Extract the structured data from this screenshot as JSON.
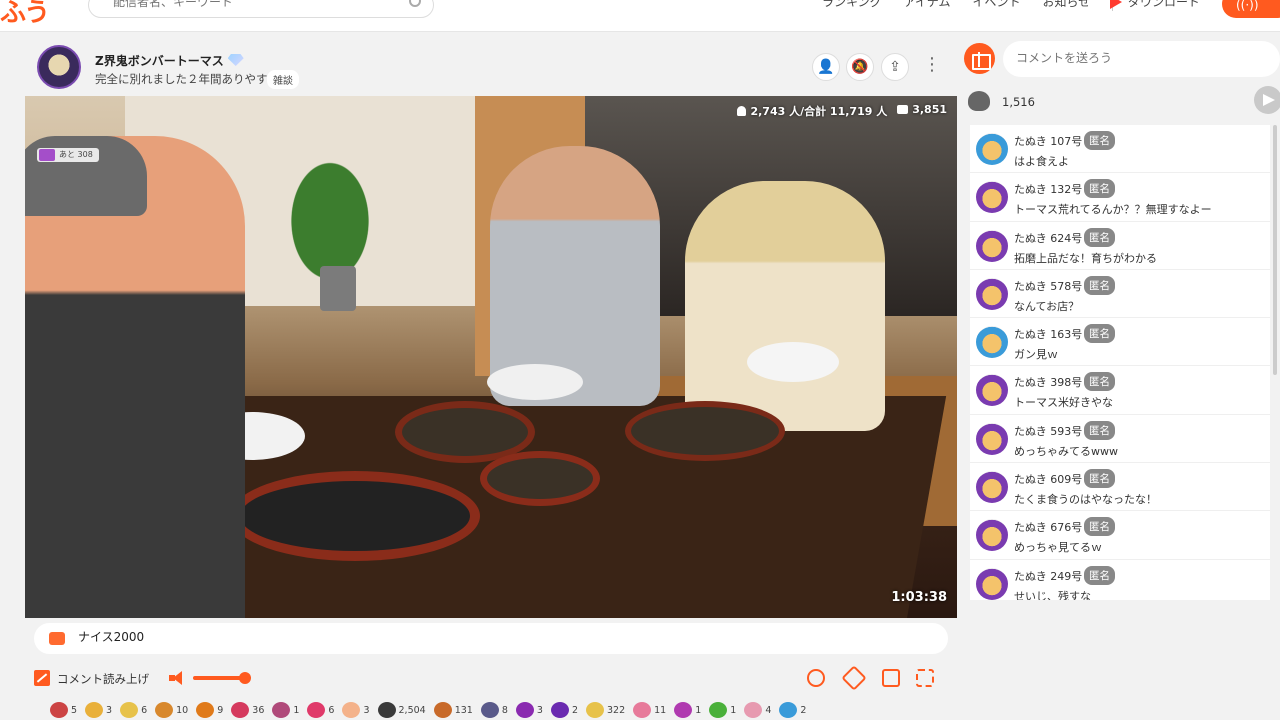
{
  "header": {
    "search_placeholder": "配信者名、キーワード",
    "nav": [
      "ランキング",
      "アイテム",
      "イベント",
      "お知らせ"
    ],
    "download_label": "ダウンロード"
  },
  "stream": {
    "title": "Z界鬼ボンバートーマス",
    "subtitle": "完全に別れました２年間ありやす",
    "tag": "雑談",
    "badge_left": "あと 308",
    "viewers": "2,743 人/合計 11,719 人",
    "comment_count": "3,851",
    "elapsed": "1:03:38"
  },
  "comment_input": {
    "value": "ナイス2000"
  },
  "controls": {
    "read_aloud_label": "コメント読み上げ",
    "volume_level": 1.0
  },
  "gifts": [
    {
      "count": "5",
      "color": "#c44"
    },
    {
      "count": "3",
      "color": "#e9b03a"
    },
    {
      "count": "6",
      "color": "#e7c24a"
    },
    {
      "count": "10",
      "color": "#d8882d"
    },
    {
      "count": "9",
      "color": "#e07a1a"
    },
    {
      "count": "36",
      "color": "#d53a5e"
    },
    {
      "count": "1",
      "color": "#b04a7a"
    },
    {
      "count": "6",
      "color": "#e03a6a"
    },
    {
      "count": "3",
      "color": "#f4b28a"
    },
    {
      "count": "2,504",
      "color": "#3a3a3a"
    },
    {
      "count": "131",
      "color": "#c86a2a"
    },
    {
      "count": "8",
      "color": "#5a5a8a"
    },
    {
      "count": "3",
      "color": "#8a2ab0"
    },
    {
      "count": "2",
      "color": "#6a2ab0"
    },
    {
      "count": "322",
      "color": "#e7c24a"
    },
    {
      "count": "11",
      "color": "#e77a9a"
    },
    {
      "count": "1",
      "color": "#b03ab0"
    },
    {
      "count": "1",
      "color": "#4ab03a"
    },
    {
      "count": "4",
      "color": "#e79ab0"
    },
    {
      "count": "2",
      "color": "#3a9bd9"
    }
  ],
  "chat": {
    "input_placeholder": "コメントを送ろう",
    "clap_count": "1,516",
    "anon_label": "匿名",
    "comments": [
      {
        "name": "たぬき 107号",
        "text": "はよ食えよ",
        "avatar": "blue"
      },
      {
        "name": "たぬき 132号",
        "text": "トーマス荒れてるんか？？無理すなよー",
        "avatar": "purple"
      },
      {
        "name": "たぬき 624号",
        "text": "拓磨上品だな！育ちがわかる",
        "avatar": "purple"
      },
      {
        "name": "たぬき 578号",
        "text": "なんてお店？",
        "avatar": "purple"
      },
      {
        "name": "たぬき 163号",
        "text": "ガン見ｗ",
        "avatar": "blue"
      },
      {
        "name": "たぬき 398号",
        "text": "トーマス米好きやな",
        "avatar": "purple"
      },
      {
        "name": "たぬき 593号",
        "text": "めっちゃみてるwww",
        "avatar": "purple"
      },
      {
        "name": "たぬき 609号",
        "text": "たくま食うのはやなったな！",
        "avatar": "purple"
      },
      {
        "name": "たぬき 676号",
        "text": "めっちゃ見てるｗ",
        "avatar": "purple"
      },
      {
        "name": "たぬき 249号",
        "text": "せいじ、残すな",
        "avatar": "purple"
      }
    ]
  }
}
